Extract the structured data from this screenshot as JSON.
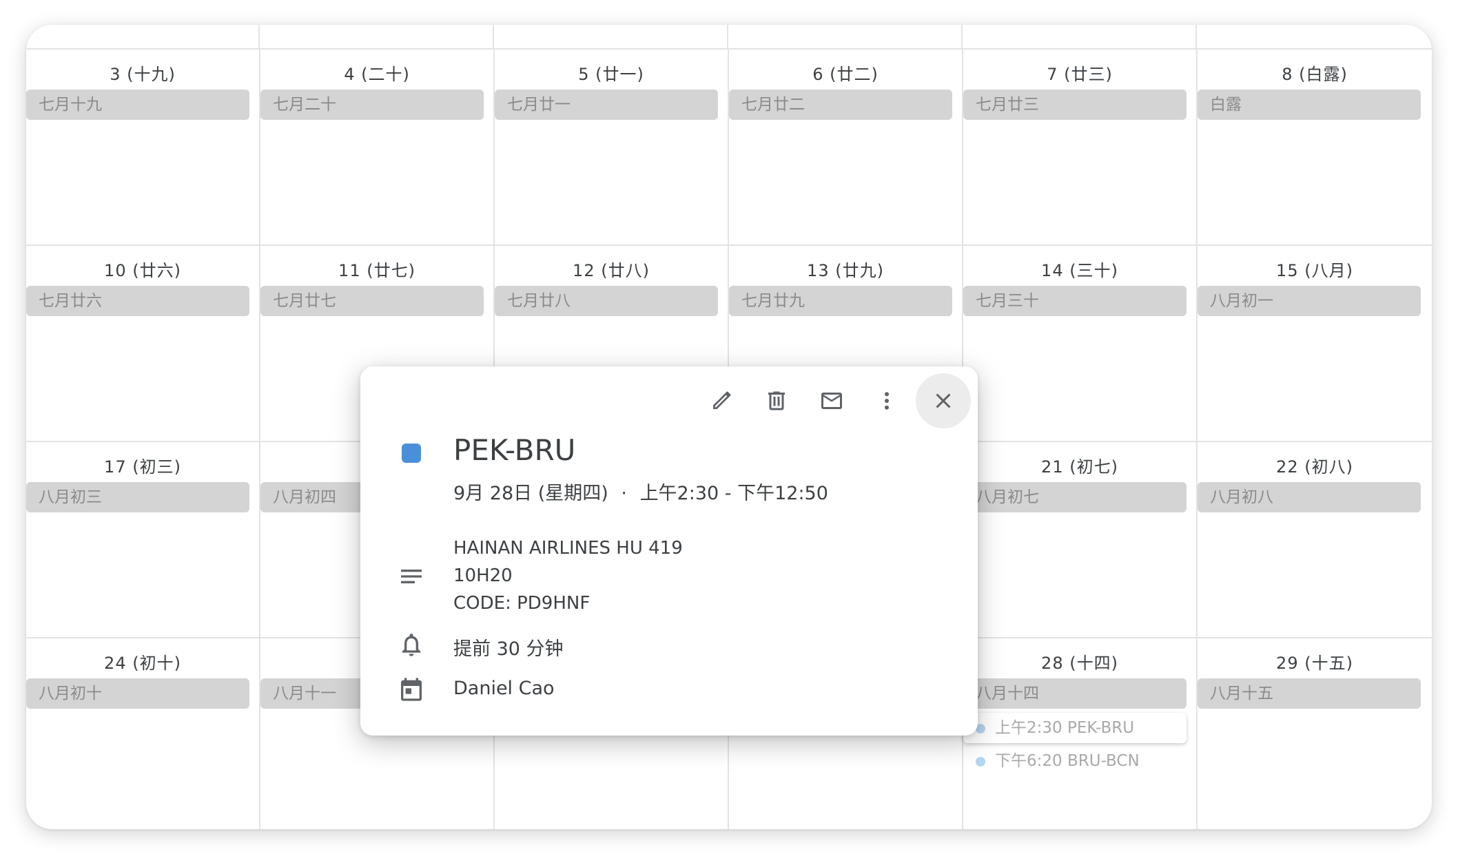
{
  "weeks": [
    {
      "days": [
        {
          "label": "3 (十九)",
          "lunar": "七月十九"
        },
        {
          "label": "4 (二十)",
          "lunar": "七月二十"
        },
        {
          "label": "5 (廿一)",
          "lunar": "七月廿一"
        },
        {
          "label": "6 (廿二)",
          "lunar": "七月廿二"
        },
        {
          "label": "7 (廿三)",
          "lunar": "七月廿三"
        },
        {
          "label": "8 (白露)",
          "lunar": "白露"
        }
      ]
    },
    {
      "days": [
        {
          "label": "10 (廿六)",
          "lunar": "七月廿六"
        },
        {
          "label": "11 (廿七)",
          "lunar": "七月廿七"
        },
        {
          "label": "12 (廿八)",
          "lunar": "七月廿八"
        },
        {
          "label": "13 (廿九)",
          "lunar": "七月廿九"
        },
        {
          "label": "14 (三十)",
          "lunar": "七月三十"
        },
        {
          "label": "15 (八月)",
          "lunar": "八月初一"
        }
      ]
    },
    {
      "days": [
        {
          "label": "17 (初三)",
          "lunar": "八月初三"
        },
        {
          "label": "",
          "lunar": "八月初四"
        },
        {
          "label": "",
          "lunar": ""
        },
        {
          "label": "",
          "lunar": ""
        },
        {
          "label": "21 (初七)",
          "lunar": "八月初七"
        },
        {
          "label": "22 (初八)",
          "lunar": "八月初八"
        }
      ]
    },
    {
      "days": [
        {
          "label": "24 (初十)",
          "lunar": "八月初十"
        },
        {
          "label": "",
          "lunar": "八月十一"
        },
        {
          "label": "",
          "lunar": ""
        },
        {
          "label": "",
          "lunar": ""
        },
        {
          "label": "28 (十四)",
          "lunar": "八月十四"
        },
        {
          "label": "29 (十五)",
          "lunar": "八月十五"
        }
      ]
    }
  ],
  "events_28": [
    {
      "time": "上午2:30",
      "title": "PEK-BRU"
    },
    {
      "time": "下午6:20",
      "title": "BRU-BCN"
    }
  ],
  "popup": {
    "color": "#4a90d9",
    "title": "PEK-BRU",
    "date": "9月 28日 (星期四)",
    "separator": "·",
    "time_range": "上午2:30 - 下午12:50",
    "description": [
      "HAINAN AIRLINES HU 419",
      "10H20",
      "CODE: PD9HNF"
    ],
    "reminder": "提前 30 分钟",
    "organizer": "Daniel Cao",
    "icons": {
      "edit": "pencil-icon",
      "delete": "trash-icon",
      "email": "mail-icon",
      "more": "more-vert-icon",
      "close": "close-icon",
      "description": "notes-icon",
      "reminder": "bell-icon",
      "calendar": "calendar-icon"
    }
  }
}
